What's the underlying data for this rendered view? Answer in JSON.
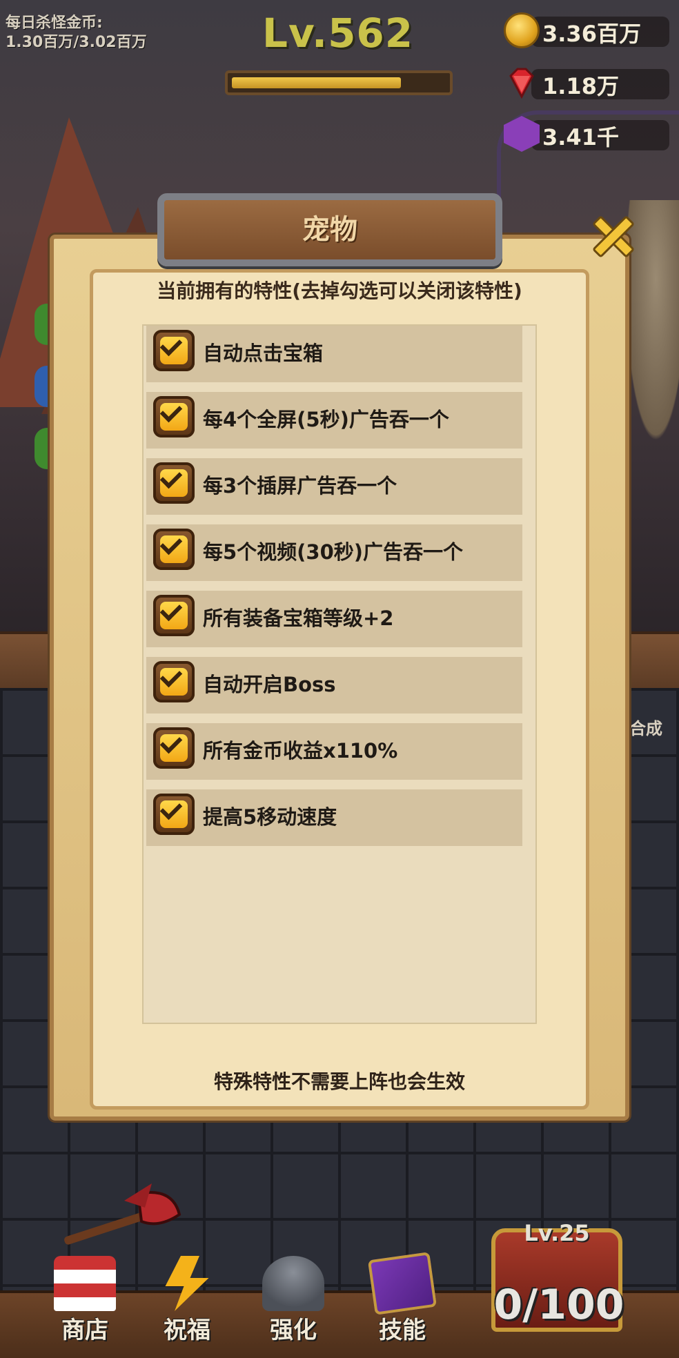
{
  "hud": {
    "daily_kill_gold_label": "每日杀怪金币:",
    "daily_kill_gold_value": "1.30百万/3.02百万",
    "level": "Lv.562",
    "xp_progress": 0.8,
    "gold": "3.36百万",
    "ruby": "1.18万",
    "purple_gem": "3.41千"
  },
  "dialog": {
    "title": "宠物",
    "subtitle": "当前拥有的特性(去掉勾选可以关闭该特性)",
    "traits": [
      {
        "label": "自动点击宝箱",
        "checked": true
      },
      {
        "label": "每4个全屏(5秒)广告吞一个",
        "checked": true
      },
      {
        "label": "每3个插屏广告吞一个",
        "checked": true
      },
      {
        "label": "每5个视频(30秒)广告吞一个",
        "checked": true
      },
      {
        "label": "所有装备宝箱等级+2",
        "checked": true
      },
      {
        "label": "自动开启Boss",
        "checked": true
      },
      {
        "label": "所有金币收益x110%",
        "checked": true
      },
      {
        "label": "提高5移动速度",
        "checked": true
      }
    ],
    "footer_note": "特殊特性不需要上阵也会生效"
  },
  "side": {
    "merge_label": "合成"
  },
  "bottom_nav": [
    {
      "label": "商店",
      "icon": "shop-icon"
    },
    {
      "label": "祝福",
      "icon": "lightning-icon"
    },
    {
      "label": "强化",
      "icon": "anvil-icon"
    },
    {
      "label": "技能",
      "icon": "spellbook-icon"
    }
  ],
  "chest": {
    "level": "Lv.25",
    "count": "0/100"
  },
  "colors": {
    "checkbox_fill": "#f2a716",
    "level_text": "#c9c24a",
    "panel": "#e8cf93"
  }
}
